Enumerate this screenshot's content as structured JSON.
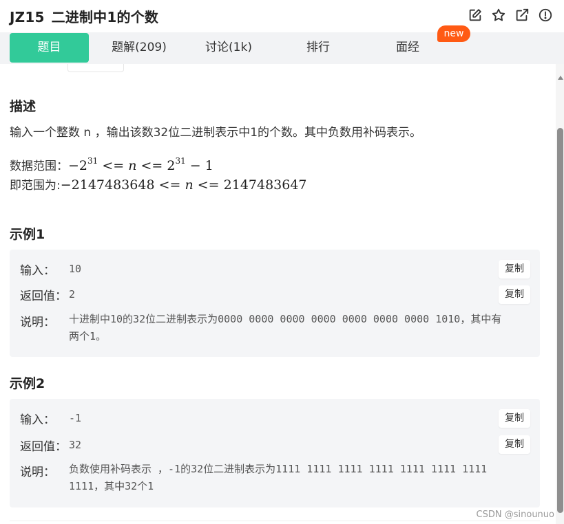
{
  "header": {
    "code": "JZ15",
    "title": "二进制中1的个数",
    "icons": [
      "edit-icon",
      "star-icon",
      "external-link-icon",
      "info-icon"
    ]
  },
  "tabs": [
    {
      "label": "题目",
      "active": true
    },
    {
      "label": "题解(209)",
      "active": false
    },
    {
      "label": "讨论(1k)",
      "active": false
    },
    {
      "label": "排行",
      "active": false
    },
    {
      "label": "面经",
      "active": false
    }
  ],
  "badge": "new",
  "description": {
    "heading": "描述",
    "text": "输入一个整数 n ，输出该数32位二进制表示中1的个数。其中负数用补码表示。",
    "range_label": "数据范围：",
    "range_math": {
      "base_neg": "−2",
      "exp1": "31",
      "mid": " <= ",
      "var": "n",
      "mid2": " <= ",
      "base": "2",
      "exp2": "31",
      "tail": " − 1"
    },
    "range2_label": "即范围为:",
    "range2_math": {
      "low": "−2147483648",
      "mid": " <= ",
      "var": "n",
      "mid2": " <= ",
      "high": "2147483647"
    }
  },
  "examples": [
    {
      "heading": "示例1",
      "input_label": "输入：",
      "input": "10",
      "output_label": "返回值：",
      "output": "2",
      "explain_label": "说明：",
      "explain": "十进制中10的32位二进制表示为0000 0000 0000 0000 0000 0000 0000 1010，其中有两个1。",
      "copy": "复制"
    },
    {
      "heading": "示例2",
      "input_label": "输入：",
      "input": "-1",
      "output_label": "返回值：",
      "output": "32",
      "explain_label": "说明：",
      "explain": "负数使用补码表示 ，-1的32位二进制表示为1111 1111 1111 1111 1111 1111 1111 1111，其中32个1",
      "copy": "复制"
    }
  ],
  "watermark": "CSDN @sinounuo",
  "colors": {
    "accent": "#32ca99",
    "badge": "#ff5a14",
    "panel": "#f4f5f7",
    "tabbar": "#f2f3f5"
  }
}
